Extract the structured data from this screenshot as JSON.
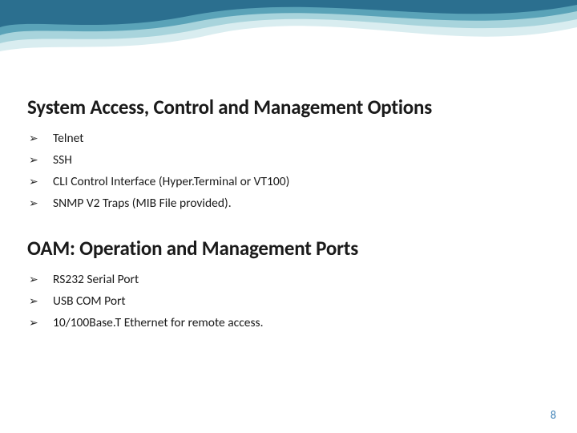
{
  "section1": {
    "heading": "System Access, Control and Management Options",
    "items": [
      "Telnet",
      "SSH",
      "CLI Control Interface (Hyper.Terminal or VT100)",
      "SNMP V2 Traps (MIB File provided)."
    ]
  },
  "section2": {
    "heading": "OAM: Operation and Management Ports",
    "items": [
      "RS232 Serial Port",
      "USB COM Port",
      "10/100Base.T Ethernet for remote access."
    ]
  },
  "bullet_glyph": "➢",
  "page_number": "8",
  "wave_colors": {
    "dark": "#2b6f8f",
    "mid": "#5aa3b8",
    "light": "#a8d4dc",
    "pale": "#d9edf0"
  }
}
